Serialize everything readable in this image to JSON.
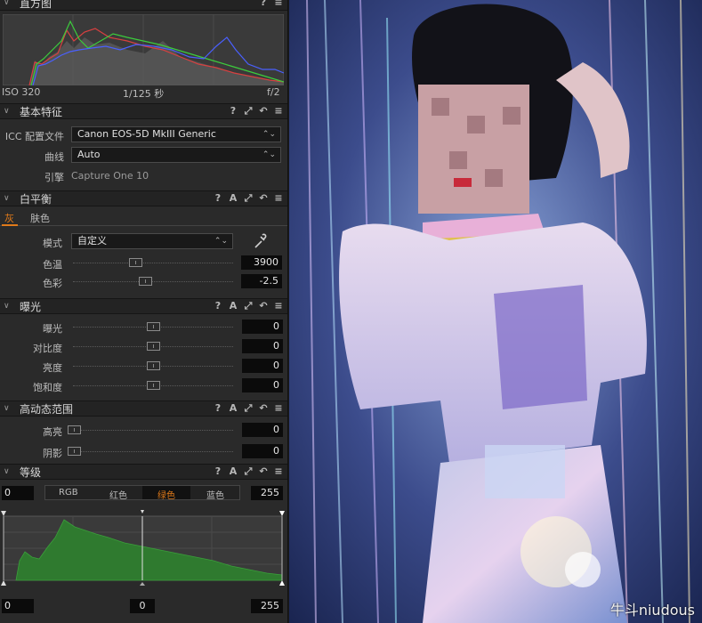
{
  "histogram": {
    "title": "直方图",
    "iso": "ISO 320",
    "shutter": "1/125 秒",
    "aperture": "f/2",
    "help": "?"
  },
  "base": {
    "title": "基本特征",
    "icc_label": "ICC 配置文件",
    "icc_value": "Canon EOS-5D MkIII Generic",
    "curve_label": "曲线",
    "curve_value": "Auto",
    "engine_label": "引擎",
    "engine_value": "Capture One 10"
  },
  "wb": {
    "title": "白平衡",
    "tab_gray": "灰",
    "tab_skin": "肤色",
    "mode_label": "模式",
    "mode_value": "自定义",
    "temp_label": "色温",
    "temp_value": "3900",
    "temp_level": 0.38,
    "tint_label": "色彩",
    "tint_value": "-2.5",
    "tint_level": 0.45
  },
  "exposure": {
    "title": "曝光",
    "rows": [
      {
        "label": "曝光",
        "value": "0",
        "level": 0.5
      },
      {
        "label": "对比度",
        "value": "0",
        "level": 0.5
      },
      {
        "label": "亮度",
        "value": "0",
        "level": 0.5
      },
      {
        "label": "饱和度",
        "value": "0",
        "level": 0.5
      }
    ]
  },
  "hdr": {
    "title": "高动态范围",
    "rows": [
      {
        "label": "高亮",
        "value": "0",
        "level": 0
      },
      {
        "label": "阴影",
        "value": "0",
        "level": 0
      }
    ]
  },
  "levels": {
    "title": "等级",
    "in_low": "0",
    "in_high": "255",
    "channels": [
      "RGB",
      "红色",
      "绿色",
      "蓝色"
    ],
    "active_channel": "绿色",
    "out_low": "0",
    "out_mid": "0",
    "out_high": "255"
  },
  "watermark": "牛斗niudous",
  "colors": {
    "panel": "#2a2a2a",
    "header": "#232323",
    "accent": "#e07a1a",
    "levels_fill": "#2f7a2f"
  }
}
